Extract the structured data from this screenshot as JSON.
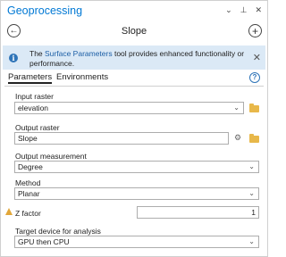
{
  "window": {
    "title": "Geoprocessing",
    "controls": [
      "⌄",
      "⊥",
      "✕"
    ]
  },
  "tool": {
    "name": "Slope",
    "back_glyph": "←",
    "add_glyph": "+"
  },
  "info": {
    "prefix": "The ",
    "link": "Surface Parameters",
    "suffix": " tool provides enhanced functionality or performance.",
    "close_glyph": "✕"
  },
  "tabs": [
    {
      "label": "Parameters",
      "active": true
    },
    {
      "label": "Environments",
      "active": false
    }
  ],
  "help_glyph": "?",
  "params": {
    "input_raster": {
      "label": "Input raster",
      "value": "elevation"
    },
    "output_raster": {
      "label": "Output raster",
      "value": "Slope"
    },
    "output_measurement": {
      "label": "Output measurement",
      "value": "Degree"
    },
    "method": {
      "label": "Method",
      "value": "Planar"
    },
    "z_factor": {
      "label": "Z factor",
      "value": "1"
    },
    "target_device": {
      "label": "Target device for analysis",
      "value": "GPU then CPU"
    }
  },
  "icons": {
    "caret": "⌄",
    "symbology": "⚙"
  },
  "colors": {
    "accent": "#0078d4",
    "info_bg": "#dbe9f6",
    "warning": "#e2a73a",
    "folder": "#e8b84a"
  }
}
